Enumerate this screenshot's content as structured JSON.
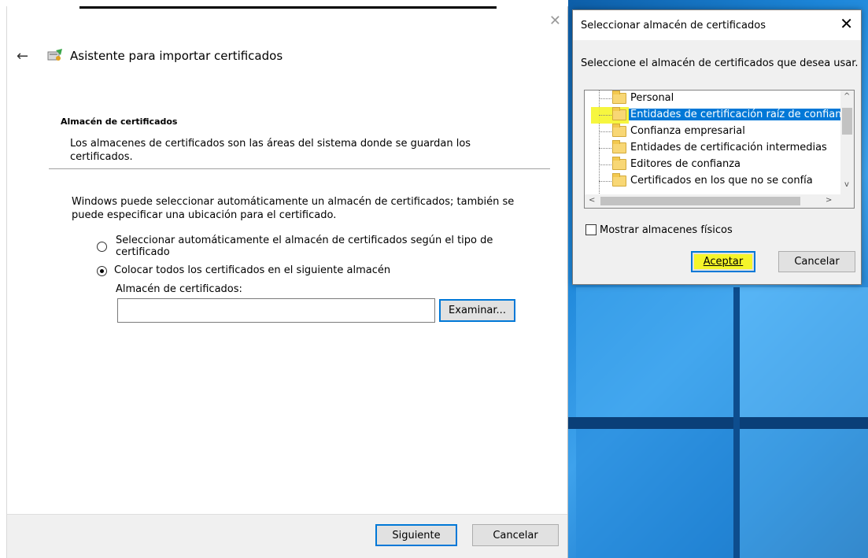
{
  "wizard": {
    "title": "Asistente para importar certificados",
    "close_symbol": "✕",
    "back_symbol": "←",
    "section_title": "Almacén de certificados",
    "section_desc": "Los almacenes de certificados son las áreas del sistema donde se guardan los certificados.",
    "body_text": "Windows puede seleccionar automáticamente un almacén de certificados; también se puede especificar una ubicación para el certificado.",
    "radio_auto_label": "Seleccionar automáticamente el almacén de certificados según el tipo de certificado",
    "radio_place_label": "Colocar todos los certificados en el siguiente almacén",
    "store_label": "Almacén de certificados:",
    "store_value": "",
    "browse_label": "Examinar...",
    "next_label": "Siguiente",
    "cancel_label": "Cancelar"
  },
  "dialog": {
    "title": "Seleccionar almacén de certificados",
    "close_symbol": "✕",
    "prompt": "Seleccione el almacén de certificados que desea usar.",
    "stores": [
      {
        "label": "Personal"
      },
      {
        "label": "Entidades de certificación raíz de confian"
      },
      {
        "label": "Confianza empresarial"
      },
      {
        "label": "Entidades de certificación intermedias"
      },
      {
        "label": "Editores de confianza"
      },
      {
        "label": "Certificados en los que no se confía"
      }
    ],
    "show_physical_label": "Mostrar almacenes físicos",
    "accept_label": "Aceptar",
    "cancel_label": "Cancelar",
    "scroll_up": "^",
    "scroll_down": "v",
    "scroll_left": "<",
    "scroll_right": ">"
  },
  "colors": {
    "selection": "#0078d7",
    "highlight": "#f5f52a"
  },
  "icons": [
    "back-arrow-icon",
    "certificate-wizard-icon",
    "close-icon",
    "folder-icon"
  ]
}
